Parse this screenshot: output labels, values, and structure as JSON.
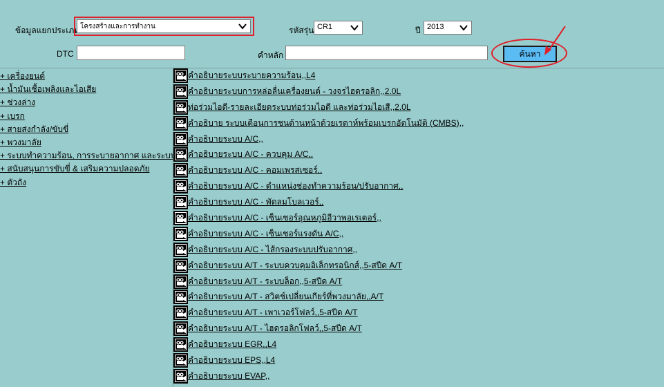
{
  "filters": {
    "category_label": "ข้อมูลแยกประเภท",
    "category_value": "โครงสร้างและการทำงาน",
    "model_label": "รหัสรุ่น",
    "model_value": "CR1",
    "year_label": "ปี",
    "year_value": "2013",
    "dtc_label": "DTC",
    "dtc_value": "",
    "keyword_label": "คำหลัก",
    "keyword_value": "",
    "search_label": "ค้นหา"
  },
  "categories": [
    "+ เครื่องยนต์",
    "+ น้ำมันเชื้อเพลิงและไอเสีย",
    "+ ช่วงล่าง",
    "+ เบรก",
    "+ สายส่งกำลัง/ขับขี่",
    "+ พวงมาลัย",
    "+ ระบบทำความร้อน, การระบายอากาศ และระบบปรับ",
    "+ สนับสนุนการขับขี่ & เสริมความปลอดภัย",
    "+ ตัวถัง"
  ],
  "documents": [
    "คำอธิบายระบบระบายความร้อน,,L4",
    "คำอธิบายระบบการหล่อลื่นเครื่องยนต์ - วงจรไฮดรอลิก,,2.0L",
    "ท่อร่วมไอดี-รายละเอียดระบบท่อร่วมไอดี และท่อร่วมไอเสี,,2.0L",
    "คำอธิบาย ระบบเตือนการชนด้านหน้าด้วยเรดาห์พร้อมเบรกอัตโนมัติ (CMBS),,",
    "คำอธิบายระบบ A/C,,",
    "คำอธิบายระบบ A/C - ควบคุม A/C,,",
    "คำอธิบายระบบ A/C - คอมเพรสเซอร์,,",
    "คำอธิบายระบบ A/C - ตำแหน่งช่องทำความร้อน/ปรับอากาศ,,",
    "คำอธิบายระบบ A/C - พัดลมโบลเวอร์,,",
    "คำอธิบายระบบ A/C - เซ็นเซอร์อุณหภูมิอีวาพอเรเตอร์,,",
    "คำอธิบายระบบ A/C - เซ็นเซอร์แรงดัน A/C,,",
    "คำอธิบายระบบ A/C - ไส้กรองระบบปรับอากาศ,,",
    "คำอธิบายระบบ A/T - ระบบควบคุมอิเล็กทรอนิกส์,,5-สปีด A/T",
    "คำอธิบายระบบ A/T - ระบบล็อก,,5-สปีด A/T",
    "คำอธิบายระบบ A/T - สวิตช์เปลี่ยนเกียร์ที่พวงมาลัย,,A/T",
    "คำอธิบายระบบ A/T - เพาเวอร์โฟลว์,,5-สปีด A/T",
    "คำอธิบายระบบ A/T - ไฮดรอลิกโฟลว์,,5-สปีด A/T",
    "คำอธิบายระบบ EGR,,L4",
    "คำอธิบายระบบ EPS,,L4",
    "คำอธิบายระบบ EVAP,,"
  ],
  "colors": {
    "background": "#99cccc",
    "highlight": "#e0202a",
    "search_button": "#5bbbf3"
  },
  "icons": {
    "document": "video-camera-icon",
    "select": "chevron-down-icon"
  }
}
